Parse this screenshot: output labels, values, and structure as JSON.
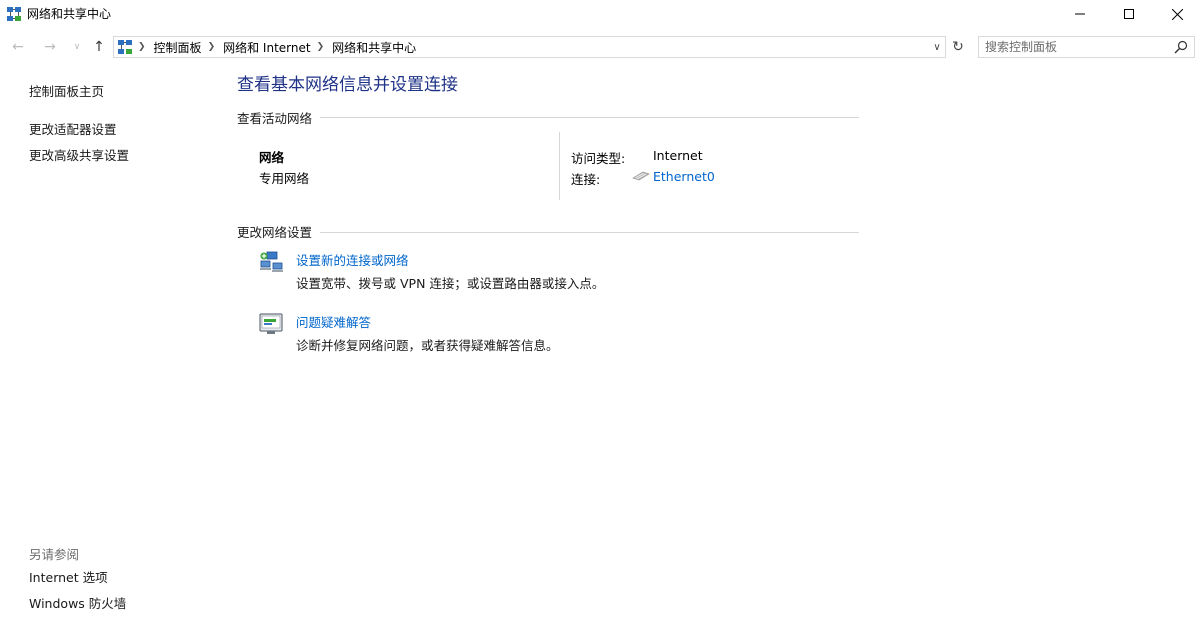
{
  "window": {
    "title": "网络和共享中心",
    "minimize_icon": "minimize-icon",
    "maximize_icon": "maximize-icon",
    "close_icon": "close-icon"
  },
  "navigation": {
    "breadcrumbs": [
      "控制面板",
      "网络和 Internet",
      "网络和共享中心"
    ],
    "search_placeholder": "搜索控制面板"
  },
  "left_pane": {
    "items": [
      "控制面板主页",
      "更改适配器设置",
      "更改高级共享设置"
    ],
    "see_also_title": "另请参阅",
    "see_also_items": [
      "Internet 选项",
      "Windows 防火墙"
    ]
  },
  "main": {
    "title": "查看基本网络信息并设置连接",
    "active_networks_heading": "查看活动网络",
    "network": {
      "name": "网络",
      "type": "专用网络",
      "access_type_label": "访问类型:",
      "access_type_value": "Internet",
      "connection_label": "连接:",
      "connection_value": "Ethernet0"
    },
    "change_settings_heading": "更改网络设置",
    "tasks": [
      {
        "icon": "new-connection-icon",
        "link": "设置新的连接或网络",
        "description": "设置宽带、拨号或 VPN 连接；或设置路由器或接入点。"
      },
      {
        "icon": "troubleshoot-icon",
        "link": "问题疑难解答",
        "description": "诊断并修复网络问题，或者获得疑难解答信息。"
      }
    ]
  },
  "colors": {
    "title_blue": "#1e3287",
    "link_blue": "#0066cc",
    "divider": "#d6d6d6"
  }
}
